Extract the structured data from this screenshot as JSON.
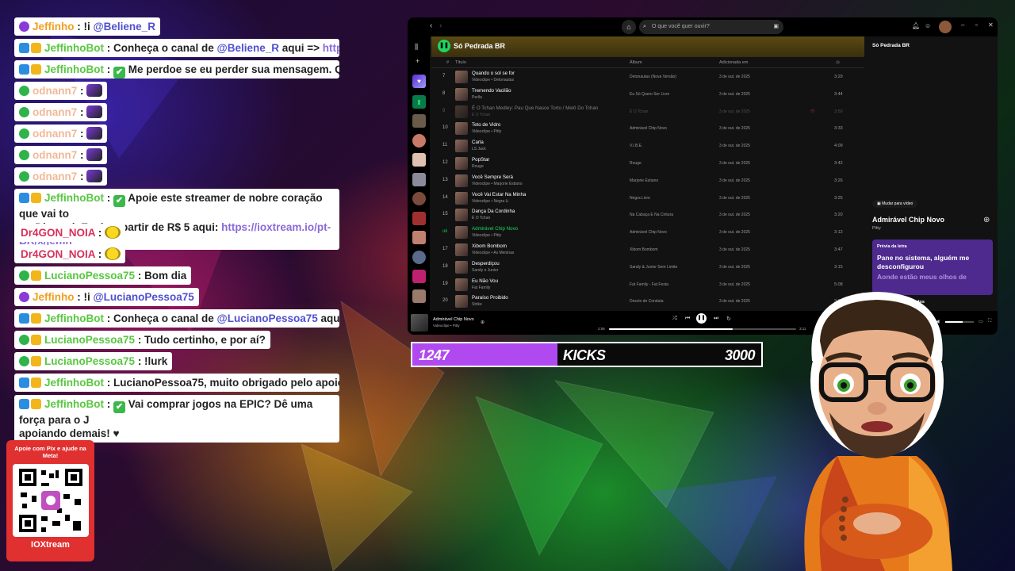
{
  "chat": [
    {
      "badges": [
        "gem"
      ],
      "user": "Jeffinho",
      "ucolor": "u-orange",
      "text": " : !i ",
      "mention": "@Beliene_R"
    },
    {
      "badges": [
        "mod",
        "crown"
      ],
      "user": "JeffinhoBot",
      "ucolor": "u-green",
      "text": " : Conheça o canal de ",
      "mention": "@Beliene_R",
      "text2": " aqui => ",
      "link": "https://kick."
    },
    {
      "badges": [
        "mod",
        "crown"
      ],
      "user": "JeffinhoBot",
      "ucolor": "u-green",
      "text": " : ",
      "check": true,
      "text2": " Me perdoe se eu perder sua mensagem. Quando"
    },
    {
      "badges": [
        "ok"
      ],
      "user": "odnann7",
      "ucolor": "u-peach",
      "text": " : ",
      "emote": "purple"
    },
    {
      "badges": [
        "ok"
      ],
      "user": "odnann7",
      "ucolor": "u-peach",
      "text": " : ",
      "emote": "purple"
    },
    {
      "badges": [
        "ok"
      ],
      "user": "odnann7",
      "ucolor": "u-peach",
      "text": " : ",
      "emote": "purple"
    },
    {
      "badges": [
        "ok"
      ],
      "user": "odnann7",
      "ucolor": "u-peach",
      "text": " : ",
      "emote": "purple"
    },
    {
      "badges": [
        "ok"
      ],
      "user": "odnann7",
      "ucolor": "u-peach",
      "text": " : ",
      "emote": "purple"
    },
    {
      "badges": [
        "mod",
        "crown"
      ],
      "user": "JeffinhoBot",
      "ucolor": "u-green",
      "text": " : ",
      "check": true,
      "text2": " Apoie este streamer de nobre coração que vai to",
      "line2": "no Discord. Envie a partir de R$ 5 aqui: ",
      "link": "https://ioxtream.io/pt-BR/x/jeffin",
      "wrap": true
    },
    {
      "badges": [],
      "user": "Dr4GON_NOIA",
      "ucolor": "u-red",
      "text": " : ",
      "emote": "yellow"
    },
    {
      "badges": [],
      "user": "Dr4GON_NOIA",
      "ucolor": "u-red",
      "text": " : ",
      "emote": "yellow"
    },
    {
      "badges": [
        "ok",
        "crown"
      ],
      "user": "LucianoPessoa75",
      "ucolor": "u-green",
      "text": " : Bom dia"
    },
    {
      "badges": [
        "gem"
      ],
      "user": "Jeffinho",
      "ucolor": "u-orange",
      "text": " : !i ",
      "mention": "@LucianoPessoa75"
    },
    {
      "badges": [
        "mod",
        "crown"
      ],
      "user": "JeffinhoBot",
      "ucolor": "u-green",
      "text": " : Conheça o canal de ",
      "mention": "@LucianoPessoa75",
      "text2": " aqui => ",
      "link": "http"
    },
    {
      "badges": [
        "ok",
        "crown"
      ],
      "user": "LucianoPessoa75",
      "ucolor": "u-green",
      "text": " : Tudo certinho, e por aí?"
    },
    {
      "badges": [
        "ok",
        "crown"
      ],
      "user": "LucianoPessoa75",
      "ucolor": "u-green",
      "text": " : !lurk"
    },
    {
      "badges": [
        "mod",
        "crown"
      ],
      "user": "JeffinhoBot",
      "ucolor": "u-green",
      "text": " : LucianoPessoa75, muito obrigado pelo apoio!"
    },
    {
      "badges": [
        "mod",
        "crown"
      ],
      "user": "JeffinhoBot",
      "ucolor": "u-green",
      "text": " : ",
      "check": true,
      "text2": " Vai comprar jogos na EPIC? Dê uma força para o J",
      "line2": "apoiando demais! ♥",
      "wrap": true
    }
  ],
  "pix": {
    "title": "Apoie com Pix e ajude na Meta!",
    "logo": "IOXtream"
  },
  "spotify": {
    "search_placeholder": "O que você quer ouvir?",
    "playlist_title": "Só Pedrada BR",
    "columns": {
      "num": "#",
      "title": "Título",
      "album": "Álbum",
      "added": "Adicionada em",
      "duration": "◷"
    },
    "tracks": [
      {
        "n": "7",
        "title": "Quando o sol se for",
        "artist": "Videoclipe • Detonautas",
        "album": "Detonautas (Nova Versão)",
        "added": "3 de out. de 2025",
        "dur": "3:29"
      },
      {
        "n": "8",
        "title": "Tremendo Vacilão",
        "artist": "Perlla",
        "album": "Eu Só Quero Ser Livre",
        "added": "3 de out. de 2025",
        "dur": "3:44"
      },
      {
        "n": "9",
        "title": "É O Tchan Medley: Pau Que Nasce Torto / Melô Do Tchan",
        "artist": "É O Tchan",
        "album": "É O Tchan",
        "added": "3 de out. de 2025",
        "dur": "3:59",
        "dim": true
      },
      {
        "n": "10",
        "title": "Teto de Vidro",
        "artist": "Videoclipe • Pitty",
        "album": "Admirável Chip Novo",
        "added": "3 de out. de 2025",
        "dur": "3:33"
      },
      {
        "n": "11",
        "title": "Carla",
        "artist": "LS Jack",
        "album": "V.I.B.E.",
        "added": "3 de out. de 2025",
        "dur": "4:09"
      },
      {
        "n": "12",
        "title": "PopStar",
        "artist": "Rouge",
        "album": "Rouge",
        "added": "3 de out. de 2025",
        "dur": "3:42"
      },
      {
        "n": "13",
        "title": "Você Sempre Será",
        "artist": "Videoclipe • Marjorie Estiano",
        "album": "Marjorie Estiano",
        "added": "3 de out. de 2025",
        "dur": "3:26"
      },
      {
        "n": "14",
        "title": "Você Vai Estar Na Minha",
        "artist": "Videoclipe • Negra Li",
        "album": "Negra Livre",
        "added": "3 de out. de 2025",
        "dur": "3:25"
      },
      {
        "n": "15",
        "title": "Dança Da Cordinha",
        "artist": "É O Tchan",
        "album": "Na Cabaça E Na Cintura",
        "added": "3 de out. de 2025",
        "dur": "3:20"
      },
      {
        "n": "",
        "title": "Admirável Chip Novo",
        "artist": "Videoclipe • Pitty",
        "album": "Admirável Chip Novo",
        "added": "3 de out. de 2025",
        "dur": "3:12",
        "playing": true
      },
      {
        "n": "17",
        "title": "Xibom Bombom",
        "artist": "Videoclipe • As Meninas",
        "album": "Xibom Bombom",
        "added": "3 de out. de 2025",
        "dur": "3:47"
      },
      {
        "n": "18",
        "title": "Desperdiçou",
        "artist": "Sandy e Junior",
        "album": "Sandy & Junior Sem Limite",
        "added": "3 de out. de 2025",
        "dur": "3:15"
      },
      {
        "n": "19",
        "title": "Eu Não Vou",
        "artist": "Fat Family",
        "album": "Fat Family - Fat Festa",
        "added": "3 de out. de 2025",
        "dur": "5:08"
      },
      {
        "n": "20",
        "title": "Paraíso Proibido",
        "artist": "Strike",
        "album": "Desvio de Conduta",
        "added": "3 de out. de 2025",
        "dur": "3:30"
      }
    ],
    "right": {
      "heading": "Só Pedrada BR",
      "switch_video": "Mudar para vídeo",
      "song": "Admirável Chip Novo",
      "artist": "Pitty",
      "lyrics_label": "Prévia da letra",
      "lyrics_line1": "Pane no sistema, alguém me desconfigurou",
      "lyrics_line2": "Aonde estão meus olhos de",
      "related": "Videoclipes relacionados"
    },
    "player": {
      "title": "Admirável Chip Novo",
      "sub": "Videoclipe • Pitty",
      "elapsed": "2:06",
      "total": "3:11"
    }
  },
  "kicks": {
    "current": "1247",
    "label": "KICKS",
    "goal": "3000",
    "progress": 0.4157,
    "color": "#b04af0"
  }
}
